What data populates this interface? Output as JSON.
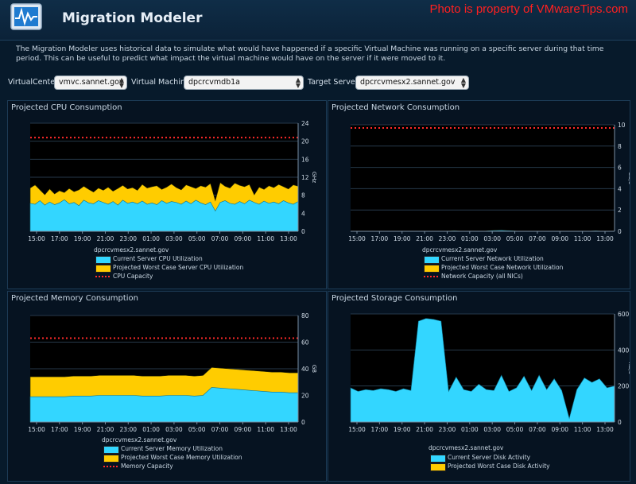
{
  "header": {
    "title": "Migration Modeler",
    "watermark": "Photo is property of VMwareTips.com",
    "icon": "monitor-graph-icon"
  },
  "description": "The Migration Modeler uses historical data to simulate what would have happened if a specific Virtual Machine was running on a specific server during that time period. This can be useful to predict what impact the virtual machine would have on the server if it were moved to it.",
  "controls": {
    "virtualcenter_label": "VirtualCenter",
    "virtualcenter_value": "vmvc.sannet.gov",
    "vm_label": "Virtual Machine",
    "vm_value": "dpcrcvmdb1a",
    "target_label": "Target Server",
    "target_value": "dpcrcvmesx2.sannet.gov"
  },
  "colors": {
    "current": "#33d6ff",
    "worst": "#ffcc00",
    "capacity": "#ff2a2a",
    "grid": "#26394a"
  },
  "panels": {
    "cpu": {
      "title": "Projected CPU Consumption",
      "server": "dpcrcvmesx2.sannet.gov",
      "legend": [
        "Current Server CPU Utilization",
        "Projected Worst Case Server CPU Utilization",
        "CPU Capacity"
      ]
    },
    "network": {
      "title": "Projected Network Consumption",
      "server": "dpcrcvmesx2.sannet.gov",
      "legend": [
        "Current Server Network Utilization",
        "Projected Worst Case Network Utilization",
        "Network Capacity (all NICs)"
      ]
    },
    "memory": {
      "title": "Projected Memory Consumption",
      "server": "dpcrcvmesx2.sannet.gov",
      "legend": [
        "Current Server Memory Utilization",
        "Projected Worst Case Memory Utilization",
        "Memory Capacity"
      ]
    },
    "storage": {
      "title": "Projected Storage Consumption",
      "server": "dpcrcvmesx2.sannet.gov",
      "legend": [
        "Current Server Disk Activity",
        "Projected Worst Case Disk Activity"
      ]
    }
  },
  "chart_data": [
    {
      "type": "area",
      "title": "Projected CPU Consumption",
      "ylabel": "GHz",
      "ylim": [
        0,
        24
      ],
      "yticks": [
        0,
        4,
        8,
        12,
        16,
        20,
        24
      ],
      "xticks": [
        "15:00",
        "17:00",
        "19:00",
        "21:00",
        "23:00",
        "01:00",
        "03:00",
        "05:00",
        "07:00",
        "09:00",
        "11:00",
        "13:00"
      ],
      "capacity": 20.8,
      "series": [
        {
          "name": "Current Server CPU Utilization",
          "values": [
            6.2,
            6.0,
            6.8,
            5.8,
            6.5,
            5.9,
            6.3,
            7.0,
            6.1,
            6.4,
            5.7,
            6.9,
            6.3,
            6.1,
            6.8,
            6.4,
            6.0,
            6.6,
            5.8,
            6.9,
            6.2,
            6.5,
            6.1,
            6.7,
            6.0,
            6.3,
            5.9,
            6.8,
            6.2,
            6.6,
            6.4,
            6.0,
            6.7,
            6.1,
            6.9,
            6.3,
            5.9,
            6.5,
            4.5,
            6.4,
            6.8,
            6.2,
            6.0,
            6.6,
            6.1,
            6.9,
            6.4,
            6.0,
            6.7,
            6.2,
            6.5,
            6.1,
            6.8,
            6.3,
            6.0,
            6.6
          ]
        },
        {
          "name": "Projected Worst Case Server CPU Utilization",
          "values": [
            9.6,
            10.3,
            9.2,
            8.1,
            9.4,
            8.3,
            9.0,
            8.6,
            9.5,
            8.8,
            9.2,
            10.0,
            9.3,
            8.7,
            9.6,
            9.1,
            9.8,
            8.9,
            9.5,
            10.2,
            9.4,
            9.7,
            9.1,
            10.4,
            9.6,
            9.9,
            10.1,
            9.3,
            9.8,
            10.5,
            9.7,
            9.2,
            10.3,
            9.9,
            9.5,
            10.1,
            9.8,
            10.6,
            6.8,
            10.8,
            10.0,
            9.6,
            10.7,
            10.2,
            9.9,
            10.4,
            8.1,
            9.8,
            9.3,
            10.1,
            9.7,
            10.4,
            9.9,
            9.4,
            10.3,
            10.0
          ]
        }
      ]
    },
    {
      "type": "area",
      "title": "Projected Network Consumption",
      "ylabel": "Gb/s",
      "ylim": [
        0,
        10
      ],
      "yticks": [
        0,
        2,
        4,
        6,
        8,
        10
      ],
      "xticks": [
        "15:00",
        "17:00",
        "19:00",
        "21:00",
        "23:00",
        "01:00",
        "03:00",
        "05:00",
        "07:00",
        "09:00",
        "11:00",
        "13:00"
      ],
      "capacity": 9.7,
      "series": [
        {
          "name": "Current Server Network Utilization",
          "values": [
            0,
            0,
            0,
            0,
            0,
            0,
            0,
            0,
            0,
            0,
            0,
            0.03,
            0,
            0,
            0,
            0.05,
            0.08,
            0.04,
            0,
            0,
            0,
            0,
            0,
            0,
            0,
            0,
            0.03,
            0,
            0
          ]
        },
        {
          "name": "Projected Worst Case Network Utilization",
          "values": [
            0,
            0,
            0,
            0,
            0,
            0,
            0,
            0,
            0,
            0,
            0,
            0.06,
            0,
            0,
            0,
            0.07,
            0.1,
            0.05,
            0,
            0,
            0,
            0,
            0,
            0,
            0,
            0,
            0.04,
            0,
            0
          ]
        }
      ]
    },
    {
      "type": "area",
      "title": "Projected Memory Consumption",
      "ylabel": "GB",
      "ylim": [
        0,
        80
      ],
      "yticks": [
        0,
        20,
        40,
        60,
        80
      ],
      "xticks": [
        "15:00",
        "17:00",
        "19:00",
        "21:00",
        "23:00",
        "01:00",
        "03:00",
        "05:00",
        "07:00",
        "09:00",
        "11:00",
        "13:00"
      ],
      "capacity": 63,
      "series": [
        {
          "name": "Current Server Memory Utilization",
          "values": [
            19,
            19,
            19,
            19,
            19,
            19.5,
            19.5,
            19.5,
            20,
            20,
            20,
            20,
            20,
            19.5,
            19.5,
            19.5,
            20,
            20,
            20,
            19.5,
            20,
            26,
            25.5,
            25,
            24.5,
            24,
            23.5,
            23,
            22.5,
            22.5,
            22,
            22
          ]
        },
        {
          "name": "Projected Worst Case Memory Utilization",
          "values": [
            34,
            34,
            34,
            34,
            34,
            34.5,
            34.5,
            34.5,
            35,
            35,
            35,
            35,
            35,
            34.5,
            34.5,
            34.5,
            35,
            35,
            35,
            34.5,
            35,
            41,
            40.5,
            40,
            39.5,
            39,
            38.5,
            38,
            37.5,
            37.5,
            37,
            37
          ]
        }
      ]
    },
    {
      "type": "area",
      "title": "Projected Storage Consumption",
      "ylabel": "KB/s",
      "ylim": [
        0,
        600
      ],
      "yticks": [
        0,
        200,
        400,
        600
      ],
      "xticks": [
        "15:00",
        "17:00",
        "19:00",
        "21:00",
        "23:00",
        "01:00",
        "03:00",
        "05:00",
        "07:00",
        "09:00",
        "11:00",
        "13:00"
      ],
      "series": [
        {
          "name": "Current Server Disk Activity",
          "values": [
            190,
            170,
            180,
            175,
            185,
            180,
            170,
            185,
            175,
            560,
            575,
            570,
            560,
            170,
            250,
            180,
            170,
            210,
            180,
            175,
            260,
            170,
            190,
            255,
            175,
            260,
            180,
            240,
            175,
            20,
            180,
            245,
            220,
            240,
            190,
            200
          ]
        },
        {
          "name": "Projected Worst Case Disk Activity",
          "values": []
        }
      ]
    }
  ]
}
